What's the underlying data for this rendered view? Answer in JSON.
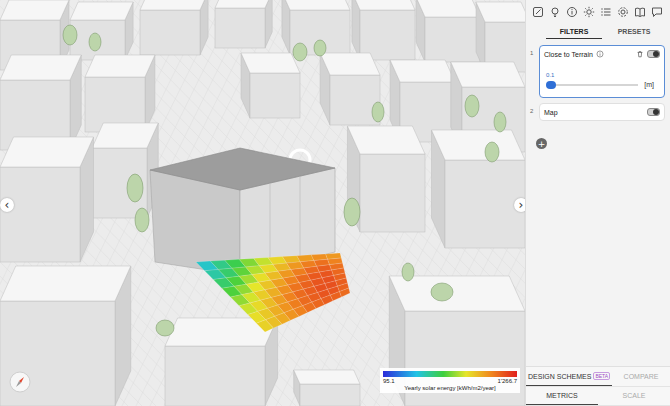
{
  "panel": {
    "tabs": [
      {
        "label": "FILTERS",
        "selected": true
      },
      {
        "label": "PRESETS",
        "selected": false
      }
    ],
    "filters": [
      {
        "index": "1",
        "name": "Close to Terrain",
        "expanded": true,
        "on": true,
        "slider": {
          "value": "0.1",
          "unit": "[m]",
          "level": 0.02
        }
      },
      {
        "index": "2",
        "name": "Map",
        "expanded": false,
        "on": true
      }
    ],
    "add_button": "+",
    "bottom_tabs": [
      [
        {
          "label": "DESIGN SCHEMES",
          "badge": "BETA",
          "selected": true
        },
        {
          "label": "COMPARE",
          "badge": "",
          "selected": false
        }
      ],
      [
        {
          "label": "METRICS",
          "badge": "",
          "selected": true
        },
        {
          "label": "SCALE",
          "badge": "",
          "selected": false
        }
      ]
    ]
  },
  "viewport": {
    "prev": "‹",
    "next": "›",
    "legend": {
      "min": "95.1",
      "max": "1'266.7",
      "title": "Yearly solar energy [kWh/m2/year]"
    },
    "solar_grid": [
      [
        430,
        520,
        600,
        700,
        780,
        860,
        930,
        990,
        1020,
        1000
      ],
      [
        480,
        560,
        660,
        760,
        850,
        930,
        1000,
        1060,
        1090,
        1050
      ],
      [
        560,
        640,
        740,
        840,
        920,
        1000,
        1060,
        1110,
        1130,
        1090
      ],
      [
        640,
        720,
        820,
        900,
        980,
        1050,
        1100,
        1140,
        1150,
        1110
      ],
      [
        720,
        800,
        880,
        950,
        1020,
        1080,
        1120,
        1150,
        1160,
        1120
      ],
      [
        790,
        850,
        920,
        990,
        1050,
        1100,
        1130,
        1160,
        1160,
        1130
      ],
      [
        840,
        890,
        950,
        1010,
        1060,
        1100,
        1130,
        1150,
        1150,
        1120
      ],
      [
        870,
        910,
        960,
        1010,
        1050,
        1090,
        1110,
        1130,
        1120,
        1100
      ]
    ]
  }
}
